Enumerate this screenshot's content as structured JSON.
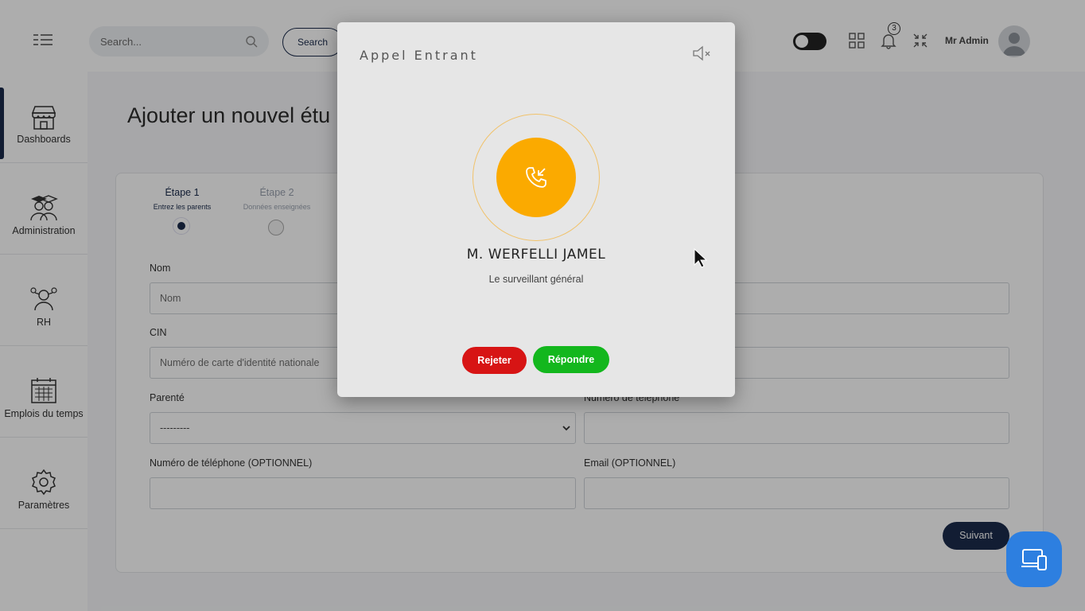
{
  "header": {
    "search_placeholder": "Search...",
    "search_button": "Search",
    "notification_count": "3",
    "user_name": "Mr Admin"
  },
  "sidebar": {
    "items": [
      {
        "label": "Dashboards",
        "icon": "storefront-icon"
      },
      {
        "label": "Administration",
        "icon": "graduates-icon"
      },
      {
        "label": "RH",
        "icon": "hr-person-icon"
      },
      {
        "label": "Emplois du temps",
        "icon": "calendar-icon"
      },
      {
        "label": "Paramètres",
        "icon": "gear-icon"
      }
    ]
  },
  "main": {
    "page_title": "Ajouter un nouvel étu",
    "steps": [
      {
        "title": "Étape 1",
        "subtitle": "Entrez les parents",
        "state": "active"
      },
      {
        "title": "Étape 2",
        "subtitle": "Données enseignées",
        "state": "inactive"
      }
    ],
    "form": {
      "nom_label": "Nom",
      "nom_placeholder": "Nom",
      "cin_label": "CIN",
      "cin_placeholder": "Numéro de carte d'identité nationale",
      "parente_label": "Parenté",
      "parente_value": "---------",
      "phone_right_label": "Numéro de téléphone",
      "phone_optional_label": "Numéro de téléphone (OPTIONNEL)",
      "email_optional_label": "Email (OPTIONNEL)"
    },
    "next_button": "Suivant"
  },
  "modal": {
    "title": "Appel Entrant",
    "caller_name": "M. WERFELLI JAMEL",
    "caller_role": "Le surveillant général",
    "reject_label": "Rejeter",
    "answer_label": "Répondre"
  },
  "colors": {
    "navy": "#1b2c4c",
    "call_orange": "#fbaa00",
    "reject_red": "#d71414",
    "answer_green": "#13b71d",
    "fab_blue": "#2d7fe0"
  }
}
